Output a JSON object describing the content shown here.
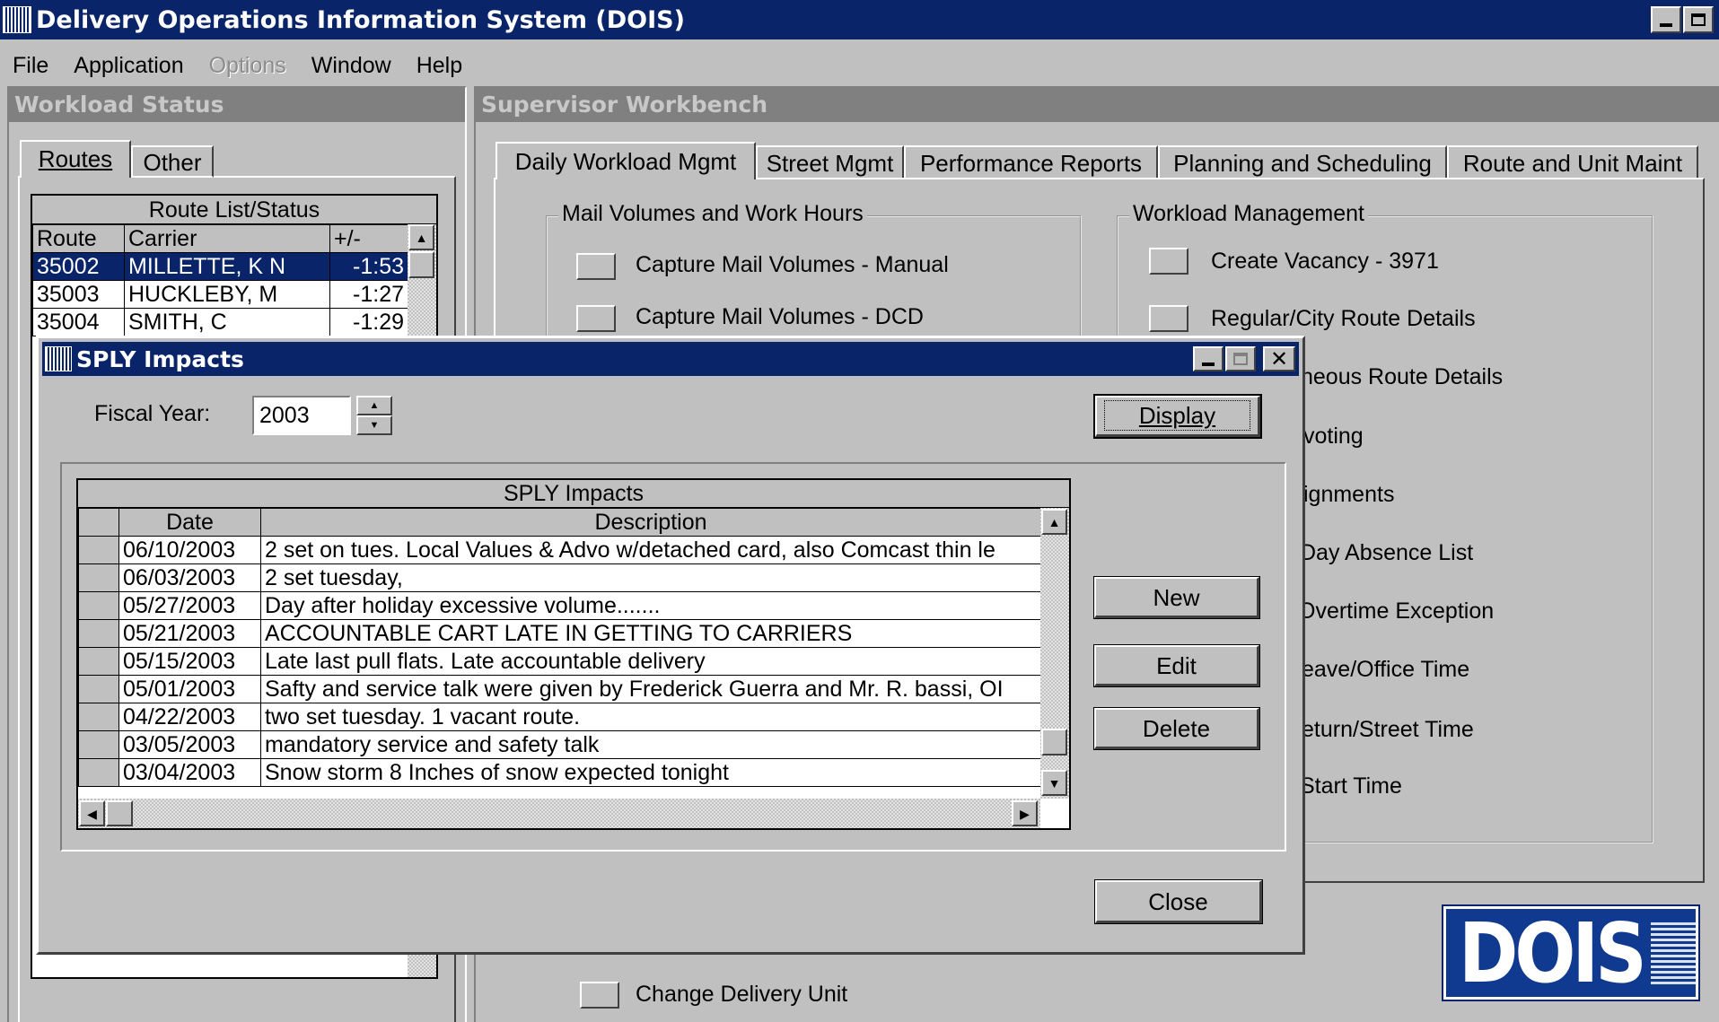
{
  "app": {
    "title": "Delivery Operations Information System (DOIS)",
    "menu": [
      "File",
      "Application",
      "Options",
      "Window",
      "Help"
    ],
    "disabled_menu": "Options",
    "logo_text": "DOIS"
  },
  "workload_status": {
    "header": "Workload Status",
    "tabs": [
      "Routes",
      "Other"
    ],
    "route_list": {
      "caption": "Route List/Status",
      "columns": [
        "Route",
        "Carrier",
        "+/-"
      ],
      "rows": [
        {
          "route": "35002",
          "carrier": "MILLETTE, K N",
          "diff": "-1:53"
        },
        {
          "route": "35003",
          "carrier": "HUCKLEBY, M",
          "diff": "-1:27"
        },
        {
          "route": "35004",
          "carrier": "SMITH, C",
          "diff": "-1:29"
        }
      ]
    }
  },
  "workbench": {
    "header": "Supervisor Workbench",
    "tabs": [
      "Daily Workload Mgmt",
      "Street Mgmt",
      "Performance Reports",
      "Planning and Scheduling",
      "Route and Unit Maint"
    ],
    "mail_group": {
      "label": "Mail Volumes and Work Hours",
      "items": [
        "Capture Mail Volumes - Manual",
        "Capture Mail Volumes - DCD"
      ]
    },
    "workload_group": {
      "label": "Workload Management",
      "items": [
        "Create Vacancy - 3971",
        "Regular/City Route Details",
        "neous Route Details",
        "voting",
        "ignments",
        "Day Absence List",
        "Overtime Exception",
        "eave/Office Time",
        "eturn/Street Time",
        "Start Time"
      ]
    },
    "change_unit": "Change Delivery Unit"
  },
  "dialog": {
    "title": "SPLY Impacts",
    "fiscal_year_label": "Fiscal Year:",
    "fiscal_year_value": "2003",
    "display_button": "Display",
    "grid": {
      "caption": "SPLY Impacts",
      "columns": [
        "Date",
        "Description"
      ],
      "rows": [
        {
          "date": "06/10/2003",
          "description": "2 set on tues. Local Values & Advo w/detached card, also Comcast thin le"
        },
        {
          "date": "06/03/2003",
          "description": "2 set tuesday,"
        },
        {
          "date": "05/27/2003",
          "description": "Day after holiday excessive volume......."
        },
        {
          "date": "05/21/2003",
          "description": "ACCOUNTABLE CART LATE IN GETTING TO CARRIERS"
        },
        {
          "date": "05/15/2003",
          "description": "Late last pull flats. Late accountable delivery"
        },
        {
          "date": "05/01/2003",
          "description": "Safty and service talk were given by Frederick Guerra and Mr. R. bassi, OI"
        },
        {
          "date": "04/22/2003",
          "description": "two set tuesday. 1 vacant route."
        },
        {
          "date": "03/05/2003",
          "description": "mandatory service and safety talk"
        },
        {
          "date": "03/04/2003",
          "description": "Snow storm 8 Inches of snow expected tonight"
        }
      ]
    },
    "buttons": {
      "new": "New",
      "edit": "Edit",
      "delete": "Delete",
      "close": "Close"
    }
  },
  "colors": {
    "titlebar": "#0a246a",
    "face": "#c0c0c0",
    "selection": "#0a246a",
    "panel_header": "#808080"
  }
}
